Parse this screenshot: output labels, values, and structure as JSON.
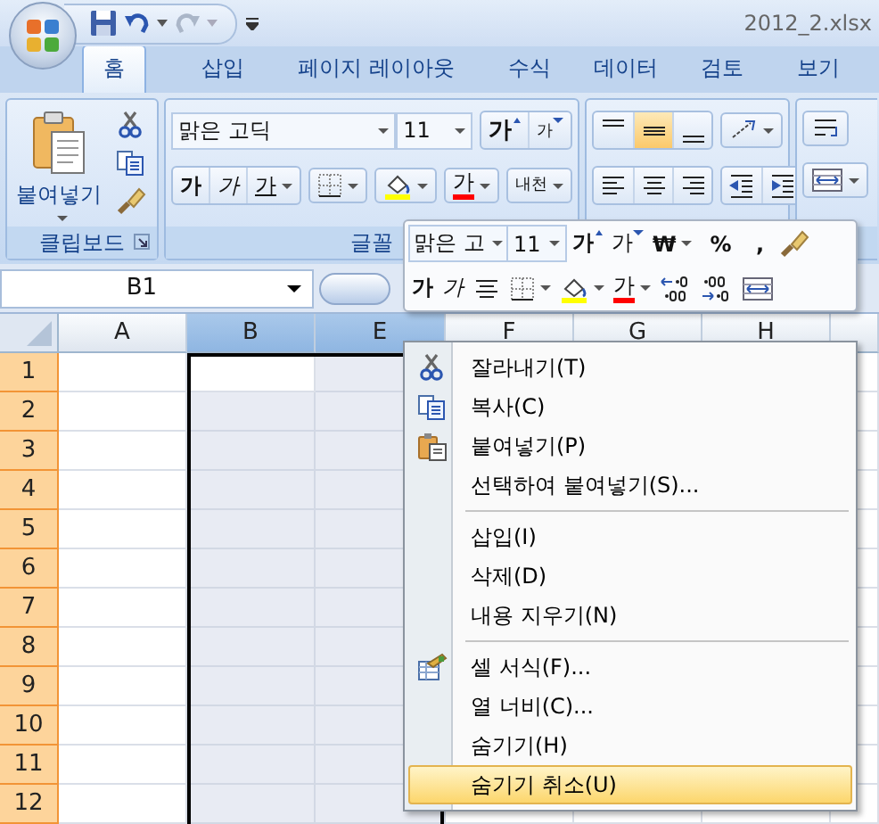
{
  "window": {
    "title": "2012_2.xlsx"
  },
  "tabs": [
    {
      "label": "홈",
      "selected": true
    },
    {
      "label": "삽입",
      "selected": false
    },
    {
      "label": "페이지 레이아웃",
      "selected": false
    },
    {
      "label": "수식",
      "selected": false
    },
    {
      "label": "데이터",
      "selected": false
    },
    {
      "label": "검토",
      "selected": false
    },
    {
      "label": "보기",
      "selected": false
    }
  ],
  "ribbon": {
    "clipboard": {
      "label": "클립보드",
      "paste_label": "붙여넣기"
    },
    "font": {
      "label": "글꼴",
      "font_name": "맑은 고딕",
      "font_size": "11",
      "grow": "가",
      "shrink": "가",
      "bold": "가",
      "italic": "가",
      "underline": "가",
      "font_color": "가",
      "phonetic": "내천"
    },
    "alignment": {
      "vertical": [
        {
          "selected": false
        },
        {
          "selected": true
        },
        {
          "selected": false
        }
      ]
    }
  },
  "formula_bar": {
    "name_box": "B1"
  },
  "sheet": {
    "columns": [
      {
        "label": "A",
        "selected": false
      },
      {
        "label": "B",
        "selected": true
      },
      {
        "label": "E",
        "selected": true
      },
      {
        "label": "F",
        "selected": false
      },
      {
        "label": "G",
        "selected": false
      },
      {
        "label": "H",
        "selected": false
      }
    ],
    "rows": [
      {
        "label": "1",
        "selected": true
      },
      {
        "label": "2",
        "selected": true
      },
      {
        "label": "3",
        "selected": true
      },
      {
        "label": "4",
        "selected": true
      },
      {
        "label": "5",
        "selected": true
      },
      {
        "label": "6",
        "selected": true
      },
      {
        "label": "7",
        "selected": true
      },
      {
        "label": "8",
        "selected": true
      },
      {
        "label": "9",
        "selected": true
      },
      {
        "label": "10",
        "selected": true
      },
      {
        "label": "11",
        "selected": true
      },
      {
        "label": "12",
        "selected": true
      }
    ]
  },
  "mini_toolbar": {
    "font_name": "맑은 고",
    "font_size": "11",
    "grow": "가",
    "shrink": "가",
    "currency": "₩",
    "percent": "%",
    "comma": ",",
    "bold": "가",
    "italic": "가",
    "font_color": "가"
  },
  "context_menu": [
    {
      "kind": "cut",
      "label": "잘라내기(T)",
      "selected": false
    },
    {
      "kind": "copy",
      "label": "복사(C)",
      "selected": false
    },
    {
      "kind": "paste",
      "label": "붙여넣기(P)",
      "selected": false
    },
    {
      "kind": "plain",
      "label": "선택하여 붙여넣기(S)...",
      "selected": false
    },
    {
      "kind": "separator"
    },
    {
      "kind": "plain",
      "label": "삽입(I)",
      "selected": false
    },
    {
      "kind": "plain",
      "label": "삭제(D)",
      "selected": false
    },
    {
      "kind": "plain",
      "label": "내용 지우기(N)",
      "selected": false
    },
    {
      "kind": "separator"
    },
    {
      "kind": "format",
      "label": "셀 서식(F)...",
      "selected": false
    },
    {
      "kind": "plain",
      "label": "열 너비(C)...",
      "selected": false
    },
    {
      "kind": "plain",
      "label": "숨기기(H)",
      "selected": false
    },
    {
      "kind": "plain",
      "label": "숨기기 취소(U)",
      "selected": true
    }
  ]
}
